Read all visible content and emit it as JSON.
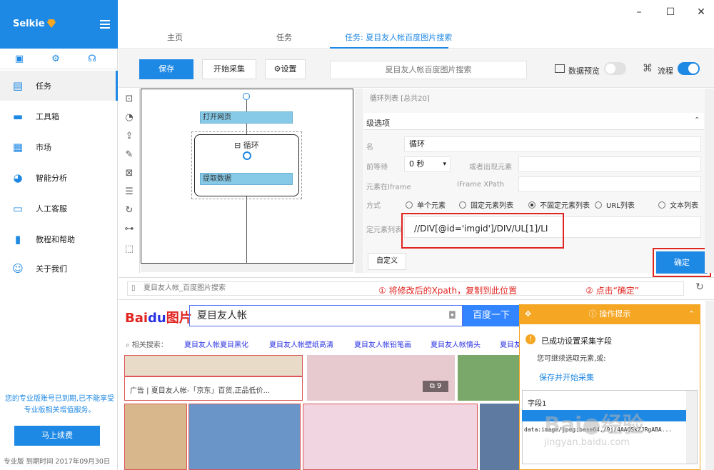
{
  "app": {
    "name": "Selkie"
  },
  "sidebar": {
    "items": [
      {
        "label": "任务"
      },
      {
        "label": "工具箱"
      },
      {
        "label": "市场"
      },
      {
        "label": "智能分析"
      },
      {
        "label": "人工客服"
      },
      {
        "label": "教程和帮助"
      },
      {
        "label": "关于我们"
      }
    ],
    "warning": "您的专业版账号已到期,已不能享受专业版相关增值服务。",
    "renew": "马上续费",
    "footer": "专业版 到期时间 2017年09月30日"
  },
  "tabs": {
    "t1": "主页",
    "t2": "任务",
    "t3": "任务: 夏目友人帐百度图片搜索"
  },
  "toolbar": {
    "save": "保存",
    "start": "开始采集",
    "settings": "设置",
    "search": "夏目友人帐百度图片搜索",
    "preview": "数据预览",
    "flow": "流程"
  },
  "flow": {
    "open": "打开网页",
    "loop": "循环",
    "extract": "提取数据"
  },
  "props": {
    "title": "循环列表 [总共20]",
    "advanced": "级选项",
    "name_lbl": "名",
    "name_val": "循环",
    "wait_lbl": "前等待",
    "wait_val": "0 秒",
    "appear_lbl": "或者出现元素",
    "iframe_lbl": "元素在Iframe",
    "iframe_xpath": "IFrame XPath",
    "mode_lbl": "方式",
    "modes": [
      "单个元素",
      "固定元素列表",
      "不固定元素列表",
      "URL列表",
      "文本列表"
    ],
    "list_lbl": "定元素列表",
    "xpath": "//DIV[@id='imgid']/DIV/UL[1]/LI",
    "custom": "自定义",
    "ok": "确定"
  },
  "browser": {
    "url": "夏目友人帐_百度图片搜索",
    "anno1": "① 将修改后的Xpath，复制到此位置",
    "anno2": "② 点击“确定”"
  },
  "baidu": {
    "logo_a": "Bai",
    "logo_b": "du",
    "logo_c": "图片",
    "query": "夏目友人帐",
    "button": "百度一下",
    "related_lbl": "相关搜索：",
    "related": [
      "夏目友人帐夏目黑化",
      "夏目友人帐壁纸高清",
      "夏目友人帐铅笔画",
      "夏目友人帐情头",
      "夏目友"
    ],
    "ad": "广告 | 夏目友人帐-「京东」百货,正品低价...",
    "badge": "9"
  },
  "tip": {
    "title": "操作提示",
    "line1": "已成功设置采集字段",
    "line2": "您可继续选取元素,或:",
    "link": "保存并开始采集",
    "col": "字段1",
    "cell": "data:image/jpeg;base64,/9j/4AAQSkZJRgABA..."
  },
  "watermark": {
    "big": "Bai●经验",
    "small": "jingyan.baidu.com"
  }
}
